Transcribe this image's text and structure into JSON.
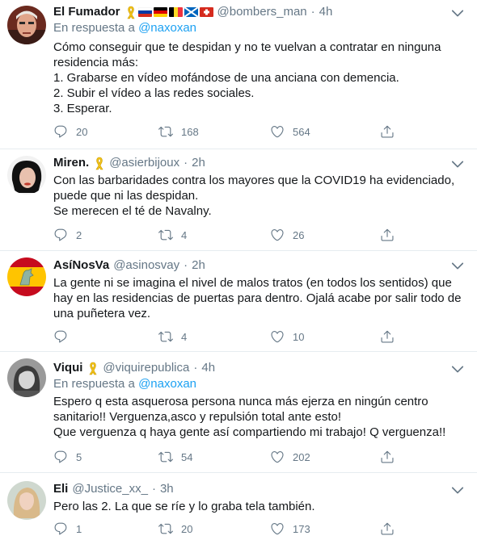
{
  "tweets": [
    {
      "name": "El Fumador",
      "handle": "@bombers_man",
      "time": "4h",
      "emoji": [
        "ribbon",
        "russia-flag",
        "germany-flag",
        "belgium-flag",
        "scotland-flag",
        "switzerland-flag"
      ],
      "reply_prefix": "En respuesta a",
      "reply_mention": "@naxoxan",
      "lines": [
        "Cómo conseguir que te despidan y no te vuelvan a contratar en ninguna",
        "residencia más:",
        "1. Grabarse en vídeo mofándose de una anciana con demencia.",
        "2. Subir el vídeo a las redes sociales.",
        "3. Esperar."
      ],
      "replies": "20",
      "retweets": "168",
      "likes": "564"
    },
    {
      "name": "Miren.",
      "handle": "@asierbijoux",
      "time": "2h",
      "emoji": [
        "ribbon"
      ],
      "lines": [
        "Con las barbaridades contra los mayores que la COVID19 ha evidenciado,",
        "puede que ni las despidan.",
        "Se merecen el té de Navalny."
      ],
      "replies": "2",
      "retweets": "4",
      "likes": "26"
    },
    {
      "name": "AsíNosVa",
      "handle": "@asinosvay",
      "time": "2h",
      "lines": [
        "La gente ni se imagina el nivel de malos tratos (en todos los sentidos) que",
        "hay en las residencias de puertas para dentro. Ojalá acabe por salir todo de",
        "una puñetera vez."
      ],
      "replies": "",
      "retweets": "4",
      "likes": "10"
    },
    {
      "name": "Viqui",
      "handle": "@viquirepublica",
      "time": "4h",
      "emoji": [
        "ribbon"
      ],
      "reply_prefix": "En respuesta a",
      "reply_mention": "@naxoxan",
      "lines": [
        "Espero q esta asquerosa persona nunca más ejerza en ningún centro",
        "sanitario!! Verguenza,asco y repulsión total ante esto!",
        "Que verguenza q haya gente así compartiendo mi trabajo! Q verguenza!!"
      ],
      "replies": "5",
      "retweets": "54",
      "likes": "202"
    },
    {
      "name": "Eli",
      "handle": "@Justice_xx_",
      "time": "3h",
      "lines": [
        "Pero las 2. La que se ríe y lo graba tela también."
      ],
      "replies": "1",
      "retweets": "20",
      "likes": "173"
    }
  ],
  "colors": {
    "link": "#1da1f2",
    "secondary": "#657786",
    "divider": "#e6ecf0",
    "ribbon": "#f5c518"
  }
}
